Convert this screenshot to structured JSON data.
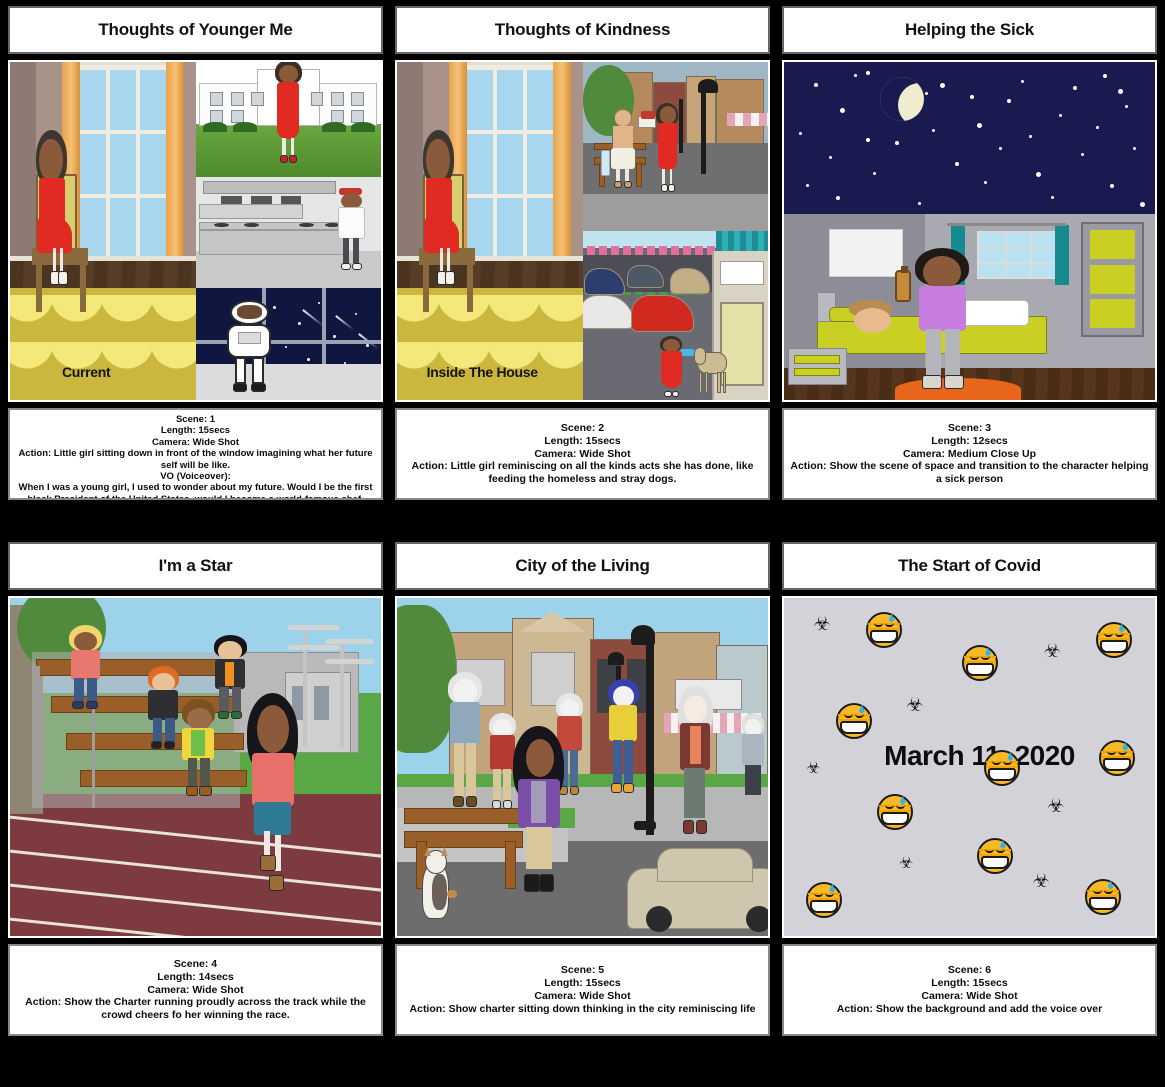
{
  "storyboard": {
    "panels": [
      {
        "id": "panel-1",
        "title": "Thoughts of Younger Me",
        "overlay_label": "Current",
        "scene_number": "Scene: 1",
        "length": "Length: 15secs",
        "camera": "Camera: Wide Shot",
        "action": "Action: Little girl sitting down in front of the window imagining what her future self will be like.",
        "vo_label": "VO (Voiceover):",
        "vo_text": "When I was a young girl, I used to wonder about my future. Would I be the first black President of the United States, would I become a world-famous chef, known for my signature dishes, or would I fulfill my dream of becoming a full-time astronaut and"
      },
      {
        "id": "panel-2",
        "title": "Thoughts of Kindness",
        "overlay_label": "Inside The House",
        "scene_number": "Scene: 2",
        "length": "Length: 15secs",
        "camera": "Camera: Wide Shot",
        "action": "Action: Little girl reminiscing on all the kinds acts she has done, like feeding the homeless and stray dogs."
      },
      {
        "id": "panel-3",
        "title": "Helping the Sick",
        "overlay_label": "",
        "scene_number": "Scene: 3",
        "length": "Length: 12secs",
        "camera": "Camera: Medium Close Up",
        "action": "Action: Show the scene of space and transition to the character helping a sick person"
      },
      {
        "id": "panel-4",
        "title": "I'm a Star",
        "overlay_label": "",
        "scene_number": "Scene: 4",
        "length": "Length: 14secs",
        "camera": "Camera: Wide Shot",
        "action": "Action: Show the Charter running proudly across the track while the crowd cheers fo her winning the race."
      },
      {
        "id": "panel-5",
        "title": "City of the Living",
        "overlay_label": "",
        "scene_number": "Scene: 5",
        "length": "Length: 15secs",
        "camera": "Camera: Wide Shot",
        "action": "Action: Show charter sitting down thinking in the city reminiscing life"
      },
      {
        "id": "panel-6",
        "title": "The Start of Covid",
        "overlay_label": "March 11, 2020",
        "scene_number": "Scene: 6",
        "length": "Length: 15secs",
        "camera": "Camera: Wide Shot",
        "action": "Action: Show the background and add the voice over"
      }
    ]
  },
  "colors": {
    "background": "#000000",
    "card": "#ffffff",
    "card_border": "#666666",
    "text": "#0b0b0b",
    "covid_bg": "#d2d2d8",
    "emoji_yellow": "#f7b928",
    "night_sky": "#191a4f",
    "rug_yellow": "#cbb63e"
  }
}
